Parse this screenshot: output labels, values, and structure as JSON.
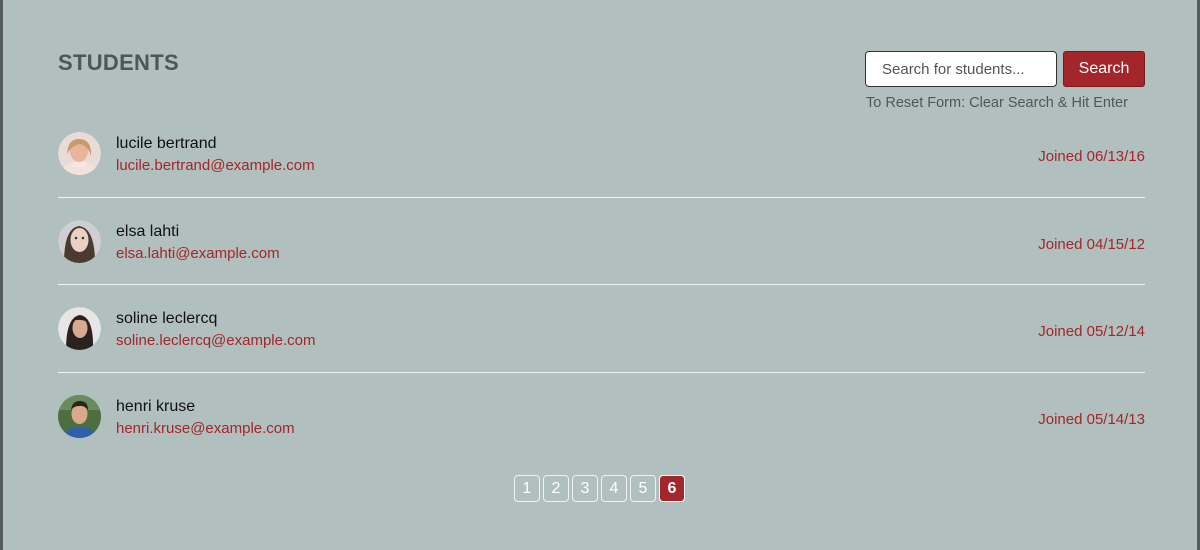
{
  "header": {
    "title": "STUDENTS"
  },
  "search": {
    "placeholder": "Search for students...",
    "value": "",
    "button_label": "Search",
    "reset_hint": "To Reset Form: Clear Search & Hit Enter"
  },
  "colors": {
    "accent": "#a3262a",
    "background": "#b1bfbe"
  },
  "students": [
    {
      "name": "lucile bertrand",
      "email": "lucile.bertrand@example.com",
      "joined": "Joined 06/13/16",
      "avatar_icon": "avatar-photo"
    },
    {
      "name": "elsa lahti",
      "email": "elsa.lahti@example.com",
      "joined": "Joined 04/15/12",
      "avatar_icon": "avatar-photo"
    },
    {
      "name": "soline leclercq",
      "email": "soline.leclercq@example.com",
      "joined": "Joined 05/12/14",
      "avatar_icon": "avatar-photo"
    },
    {
      "name": "henri kruse",
      "email": "henri.kruse@example.com",
      "joined": "Joined 05/14/13",
      "avatar_icon": "avatar-photo"
    }
  ],
  "pagination": {
    "pages": [
      "1",
      "2",
      "3",
      "4",
      "5",
      "6"
    ],
    "current": "6"
  }
}
